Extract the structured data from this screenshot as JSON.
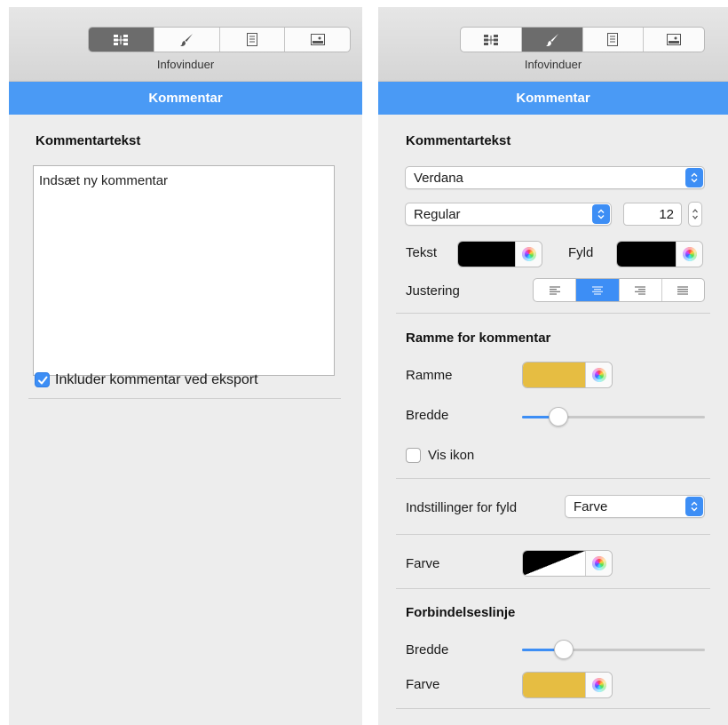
{
  "left_panel": {
    "toolbar": {
      "label": "Infovinduer",
      "buttons": [
        {
          "icon": "structure-icon",
          "active": true
        },
        {
          "icon": "brush-icon",
          "active": false
        },
        {
          "icon": "document-icon",
          "active": false
        },
        {
          "icon": "image-icon",
          "active": false
        }
      ]
    },
    "tab_title": "Kommentar",
    "section_title": "Kommentartekst",
    "comment_text": "Indsæt ny kommentar",
    "include_checkbox": {
      "label": "Inkluder kommentar ved eksport",
      "checked": true
    }
  },
  "right_panel": {
    "toolbar": {
      "label": "Infovinduer",
      "buttons": [
        {
          "icon": "structure-icon",
          "active": false
        },
        {
          "icon": "brush-icon",
          "active": true
        },
        {
          "icon": "document-icon",
          "active": false
        },
        {
          "icon": "image-icon",
          "active": false
        }
      ]
    },
    "tab_title": "Kommentar",
    "text_section": {
      "title": "Kommentartekst",
      "font_family": "Verdana",
      "font_style": "Regular",
      "font_size": "12",
      "text_color_label": "Tekst",
      "text_color": "#000000",
      "fill_label": "Fyld",
      "fill_color": "#000000",
      "alignment_label": "Justering",
      "alignment_options": [
        "left",
        "center",
        "right",
        "justify"
      ],
      "alignment_selected": "center"
    },
    "border_section": {
      "title": "Ramme for kommentar",
      "border_label": "Ramme",
      "border_color": "#e6bd42",
      "width_label": "Bredde",
      "width_level": 0.2,
      "show_icon_label": "Vis ikon",
      "show_icon_checked": false
    },
    "fill_settings": {
      "label": "Indstillinger for fyld",
      "value": "Farve"
    },
    "fill_color_row": {
      "label": "Farve"
    },
    "connection_section": {
      "title": "Forbindelseslinje",
      "width_label": "Bredde",
      "width_level": 0.23,
      "color_label": "Farve",
      "color": "#e6bd42"
    },
    "accent_color": "#3d8ef5"
  }
}
